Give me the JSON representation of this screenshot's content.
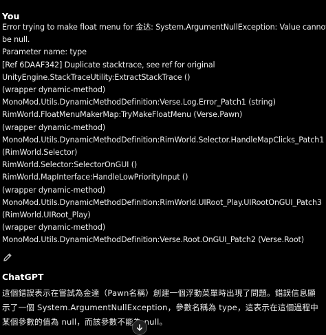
{
  "user_message": {
    "author": "You",
    "lines": [
      "Error trying to make float menu for 金达: System.ArgumentNullException: Value cannot",
      "be null.",
      "Parameter name: type",
      "[Ref 6DAAF342] Duplicate stacktrace, see ref for original",
      "UnityEngine.StackTraceUtility:ExtractStackTrace ()",
      "(wrapper dynamic-method)",
      "MonoMod.Utils.DynamicMethodDefinition:Verse.Log.Error_Patch1 (string)",
      "RimWorld.FloatMenuMakerMap:TryMakeFloatMenu (Verse.Pawn)",
      "(wrapper dynamic-method)",
      "MonoMod.Utils.DynamicMethodDefinition:RimWorld.Selector.HandleMapClicks_Patch1",
      "(RimWorld.Selector)",
      "RimWorld.Selector:SelectorOnGUI ()",
      "RimWorld.MapInterface:HandleLowPriorityInput ()",
      "(wrapper dynamic-method)",
      "MonoMod.Utils.DynamicMethodDefinition:RimWorld.UIRoot_Play.UIRootOnGUI_Patch3",
      "(RimWorld.UIRoot_Play)",
      "(wrapper dynamic-method)",
      "MonoMod.Utils.DynamicMethodDefinition:Verse.Root.OnGUI_Patch2 (Verse.Root)"
    ],
    "edit_icon": "pencil-icon"
  },
  "assistant_message": {
    "author": "ChatGPT",
    "text": "這個錯誤表示在嘗試為金達（Pawn名稱）創建一個浮動菜單時出現了問題。錯誤信息顯示了一個 System.ArgumentNullException，參數名稱為 type，這表示在這個過程中某個參數的值為 null，而該參數不能為 null。"
  },
  "scroll_button": {
    "icon": "arrow-down-icon"
  },
  "colors": {
    "background": "#000000",
    "text": "#ececec",
    "author": "#ffffff"
  }
}
